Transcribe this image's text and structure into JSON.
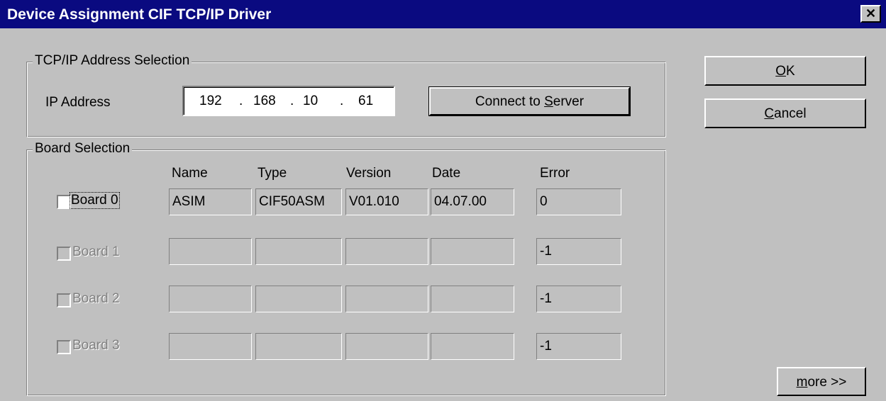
{
  "window": {
    "title": "Device Assignment CIF TCP/IP Driver",
    "close_glyph": "✕"
  },
  "tcpip": {
    "legend": "TCP/IP Address Selection",
    "ip_label": "IP Address",
    "ip_octets": [
      "192",
      "168",
      "10",
      "61"
    ],
    "ip_dot": ".",
    "connect": {
      "pre": "Connect to ",
      "accel": "S",
      "post": "erver"
    }
  },
  "boards": {
    "legend": "Board Selection",
    "headers": [
      "Name",
      "Type",
      "Version",
      "Date",
      "Error"
    ],
    "rows": [
      {
        "label": "Board 0",
        "enabled": true,
        "checked": false,
        "name": "ASIM",
        "type": "CIF50ASM",
        "version": "V01.010",
        "date": "04.07.00",
        "error": "0"
      },
      {
        "label": "Board 1",
        "enabled": false,
        "checked": false,
        "name": "",
        "type": "",
        "version": "",
        "date": "",
        "error": "-1"
      },
      {
        "label": "Board 2",
        "enabled": false,
        "checked": false,
        "name": "",
        "type": "",
        "version": "",
        "date": "",
        "error": "-1"
      },
      {
        "label": "Board 3",
        "enabled": false,
        "checked": false,
        "name": "",
        "type": "",
        "version": "",
        "date": "",
        "error": "-1"
      }
    ]
  },
  "buttons": {
    "ok": {
      "accel": "O",
      "rest": "K"
    },
    "cancel": {
      "accel": "C",
      "rest": "ancel"
    },
    "more": {
      "accel": "m",
      "rest": "ore >>"
    }
  }
}
